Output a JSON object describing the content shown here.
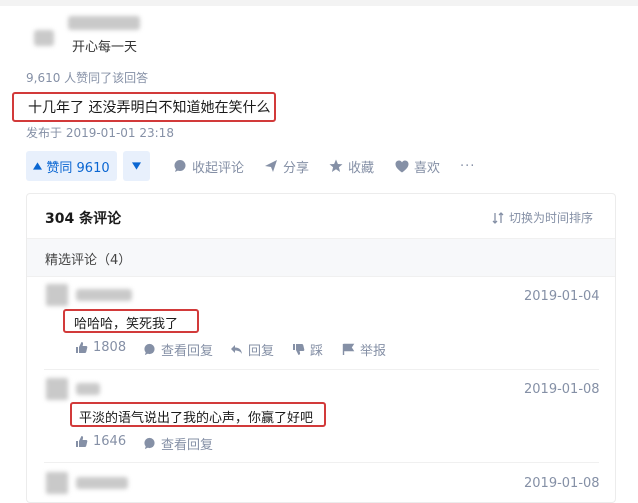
{
  "author": {
    "bio": "开心每一天"
  },
  "answer": {
    "upvote_summary": "9,610 人赞同了该回答",
    "content": "十几年了 还没弄明白不知道她在笑什么",
    "published": "发布于 2019-01-01 23:18"
  },
  "actions": {
    "upvote_label": "赞同 9610",
    "collapse_comments": "收起评论",
    "share": "分享",
    "favorite": "收藏",
    "like": "喜欢",
    "more": "···"
  },
  "comments_panel": {
    "count_label": "304 条评论",
    "sort_toggle": "切换为时间排序",
    "featured_label": "精选评论（4）",
    "items": [
      {
        "date": "2019-01-04",
        "text": "哈哈哈，笑死我了",
        "likes": "1808",
        "view_replies": "查看回复",
        "reply": "回复",
        "dislike": "踩",
        "report": "举报"
      },
      {
        "date": "2019-01-08",
        "text": "平淡的语气说出了我的心声，你赢了好吧",
        "likes": "1646",
        "view_replies": "查看回复"
      },
      {
        "date": "2019-01-08"
      }
    ]
  },
  "colors": {
    "accent": "#0a66d2",
    "highlight_box": "#d23a3a",
    "muted": "#8590a6"
  }
}
